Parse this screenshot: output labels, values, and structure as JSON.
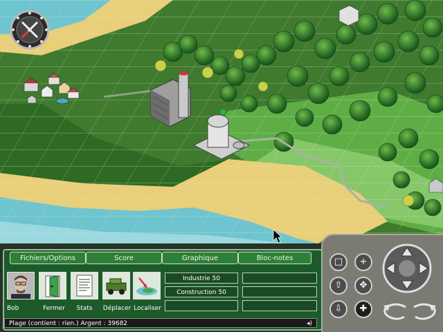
{
  "menu": {
    "tabs": [
      "Fichiers/Options",
      "Score",
      "Graphique",
      "Bloc-notes"
    ]
  },
  "toolbar": {
    "buttons": [
      {
        "label": "Bob",
        "icon": "advisor-portrait-icon"
      },
      {
        "label": "Fermer",
        "icon": "door-exit-icon"
      },
      {
        "label": "Stats",
        "icon": "stats-document-icon"
      },
      {
        "label": "Déplacer",
        "icon": "jeep-move-icon"
      },
      {
        "label": "Localiser",
        "icon": "locate-island-icon"
      }
    ]
  },
  "info_fields": {
    "left": [
      "Industrie 50",
      "Construction 50",
      ""
    ],
    "right": [
      "",
      "",
      ""
    ]
  },
  "status": {
    "text": "Plage   (contient : rien.)   Argent : 39682"
  },
  "colors": {
    "panel": "#1d5a2a",
    "water": "#6ec4cf",
    "sand": "#e9cf7a",
    "grass": "#3f7a2e",
    "stone": "#7b7b73"
  }
}
